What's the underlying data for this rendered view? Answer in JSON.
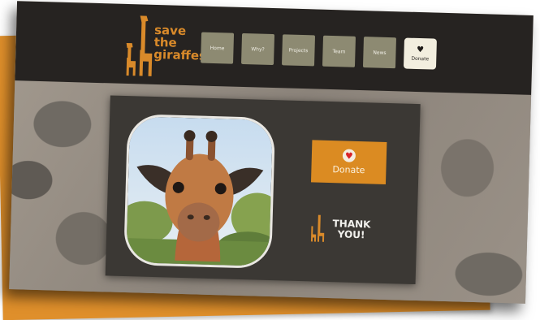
{
  "logo": {
    "line1": "save",
    "line2": "the",
    "line3": "giraffes",
    "giraffe_icon": "giraffe-icon"
  },
  "nav": [
    {
      "label": "Home"
    },
    {
      "label": "Why?"
    },
    {
      "label": "Projects"
    },
    {
      "label": "Team"
    },
    {
      "label": "News"
    },
    {
      "label": "Donate",
      "icon": "heart-icon"
    }
  ],
  "hero": {
    "donate_label": "Donate",
    "donate_icon": "heart-icon",
    "thanks_line1": "THANK",
    "thanks_line2": "YOU!"
  },
  "colors": {
    "brand_orange": "#df8f2b",
    "header_bg": "#262321",
    "panel_bg": "#3b3834",
    "nav_button": "#8d8a72",
    "donate_nav_bg": "#f2eedf",
    "heart_red": "#d8232a"
  }
}
